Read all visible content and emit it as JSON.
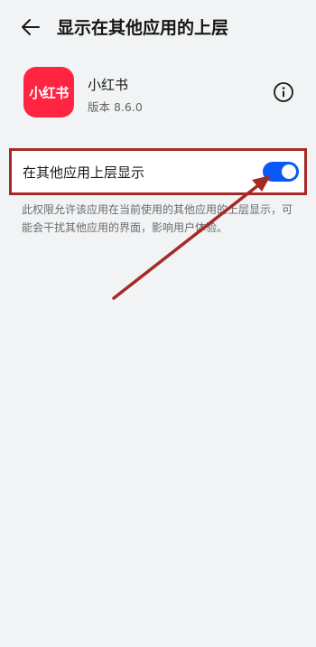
{
  "header": {
    "back_icon": "arrow-left-icon",
    "title": "显示在其他应用的上层"
  },
  "app": {
    "icon_text": "小红书",
    "name": "小红书",
    "version": "版本 8.6.0",
    "brand_color": "#ff2442",
    "info_icon": "info-circle-icon"
  },
  "permission": {
    "label": "在其他应用上层显示",
    "enabled": true,
    "toggle_color": "#0a59f7",
    "description": "此权限允许该应用在当前使用的其他应用的上层显示，可能会干扰其他应用的界面，影响用户体验。"
  },
  "annotation": {
    "highlight_color": "#a52a26",
    "arrow_icon": "pointer-arrow-icon"
  }
}
